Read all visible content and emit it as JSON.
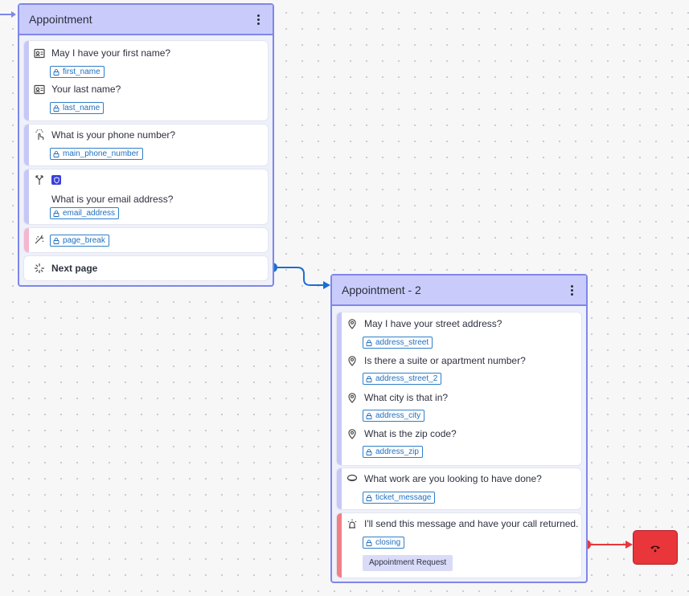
{
  "node1": {
    "title": "Appointment",
    "items": [
      {
        "question": "May I have your first name?",
        "variable": "first_name",
        "icon": "id-card-icon"
      },
      {
        "question": "Your last name?",
        "variable": "last_name",
        "icon": "id-card-icon"
      },
      {
        "question": "What is your phone number?",
        "variable": "main_phone_number",
        "icon": "phone-tap-icon"
      },
      {
        "question": "What is your email address?",
        "variable": "email_address",
        "icon": "fork-icon",
        "badge_icon": "shield-icon"
      },
      {
        "variable": "page_break",
        "icon": "sparkle-icon"
      }
    ],
    "next_page_label": "Next page"
  },
  "node2": {
    "title": "Appointment - 2",
    "items": [
      {
        "question": "May I have your street address?",
        "variable": "address_street",
        "icon": "location-pin-icon"
      },
      {
        "question": "Is there a suite or apartment number?",
        "variable": "address_street_2",
        "icon": "location-pin-icon"
      },
      {
        "question": "What city is that in?",
        "variable": "address_city",
        "icon": "location-pin-icon"
      },
      {
        "question": "What is the zip code?",
        "variable": "address_zip",
        "icon": "location-pin-icon"
      },
      {
        "question": "What work are you looking to have done?",
        "variable": "ticket_message",
        "icon": "message-icon"
      },
      {
        "question": "I'll send this message and have your call returned.",
        "variable": "closing",
        "icon": "alarm-icon"
      }
    ],
    "action_chip": "Appointment Request"
  },
  "colors": {
    "node_border": "#7f86ea",
    "node_header": "#c9ccfb",
    "connector": "#1a6fd1",
    "end_call": "#e8363b",
    "variable_tag": "#2f7fc9"
  }
}
